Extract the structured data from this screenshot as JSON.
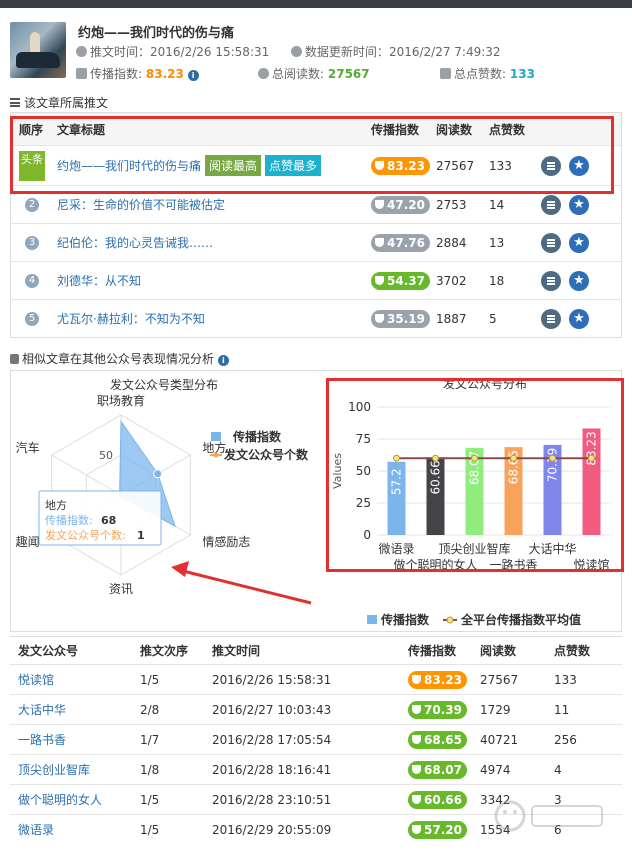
{
  "header": {
    "title": "约炮——我们时代的伤与痛",
    "publish_label": "推文时间：",
    "publish_time": "2016/2/26 15:58:31",
    "update_label": "数据更新时间：",
    "update_time": "2016/2/27 7:49:32",
    "spread_label": "传播指数:",
    "spread_value": "83.23",
    "reads_label": "总阅读数:",
    "reads_value": "27567",
    "likes_label": "总点赞数:",
    "likes_value": "133"
  },
  "section1": {
    "label": "该文章所属推文"
  },
  "table1": {
    "headers": [
      "顺序",
      "文章标题",
      "传播指数",
      "阅读数",
      "点赞数"
    ],
    "rows": [
      {
        "order": "头条",
        "title": "约炮——我们时代的伤与痛",
        "tags": [
          "阅读最高",
          "点赞最多"
        ],
        "spread": "83.23",
        "reads": "27567",
        "likes": "133",
        "style": "orange"
      },
      {
        "order": "2",
        "title": "尼采：生命的价值不可能被估定",
        "spread": "47.20",
        "reads": "2753",
        "likes": "14",
        "style": "gray"
      },
      {
        "order": "3",
        "title": "纪伯伦：我的心灵告诫我……",
        "spread": "47.76",
        "reads": "2884",
        "likes": "13",
        "style": "gray"
      },
      {
        "order": "4",
        "title": "刘德华：从不知",
        "spread": "54.37",
        "reads": "3702",
        "likes": "18",
        "style": "green"
      },
      {
        "order": "5",
        "title": "尤瓦尔·赫拉利：不知为不知",
        "spread": "35.19",
        "reads": "1887",
        "likes": "5",
        "style": "gray"
      }
    ]
  },
  "section2": {
    "label": "相似文章在其他公众号表现情况分析"
  },
  "radar": {
    "title": "发文公众号类型分布",
    "axes": [
      "职场教育",
      "地方",
      "情感励志",
      "资讯",
      "趣闻",
      "汽车"
    ],
    "tick": "50",
    "legend": [
      "传播指数",
      "发文公众号个数"
    ],
    "tooltip": {
      "title": "地方",
      "spread_label": "传播指数:",
      "spread_value": "68",
      "count_label": "发文公众号个数:",
      "count_value": "1"
    }
  },
  "chart_data": {
    "type": "bar",
    "title": "发文公众号分布",
    "ylabel": "Values",
    "xlabel": "",
    "ylim": [
      0,
      100
    ],
    "yticks": [
      "0",
      "25",
      "50",
      "75",
      "100"
    ],
    "categories": [
      "微语录",
      "做个聪明的女人",
      "顶尖创业智库",
      "一路书香",
      "大话中华",
      "悦读馆"
    ],
    "values": [
      57.2,
      60.66,
      68.07,
      68.65,
      70.39,
      83.23
    ],
    "value_labels": [
      "57.2",
      "60.66",
      "68.07",
      "68.65",
      "70.39",
      "83.23"
    ],
    "average": 60,
    "bar_colors": [
      "#7cb5ec",
      "#434348",
      "#90ed7d",
      "#f7a35c",
      "#8085e9",
      "#f15c80"
    ],
    "legend": [
      "传播指数",
      "全平台传播指数平均值"
    ],
    "legend_position": "bottom"
  },
  "table2": {
    "headers": [
      "发文公众号",
      "推文次序",
      "推文时间",
      "传播指数",
      "阅读数",
      "点赞数"
    ],
    "rows": [
      {
        "account": "悦读馆",
        "order": "1/5",
        "time": "2016/2/26 15:58:31",
        "spread": "83.23",
        "reads": "27567",
        "likes": "133",
        "style": "orange"
      },
      {
        "account": "大话中华",
        "order": "2/8",
        "time": "2016/2/27 10:03:43",
        "spread": "70.39",
        "reads": "1729",
        "likes": "11",
        "style": "green"
      },
      {
        "account": "一路书香",
        "order": "1/7",
        "time": "2016/2/28 17:05:54",
        "spread": "68.65",
        "reads": "40721",
        "likes": "256",
        "style": "green"
      },
      {
        "account": "顶尖创业智库",
        "order": "1/8",
        "time": "2016/2/28 18:16:41",
        "spread": "68.07",
        "reads": "4974",
        "likes": "4",
        "style": "green"
      },
      {
        "account": "做个聪明的女人",
        "order": "1/5",
        "time": "2016/2/28 23:10:51",
        "spread": "60.66",
        "reads": "3342",
        "likes": "3",
        "style": "green"
      },
      {
        "account": "微语录",
        "order": "1/5",
        "time": "2016/2/29 20:55:09",
        "spread": "57.20",
        "reads": "1554",
        "likes": "6",
        "style": "green"
      }
    ]
  },
  "colors": {
    "accent": "#2a6fb0",
    "highlight": "#e03030",
    "orange": "#ff9500",
    "green": "#67b82b"
  }
}
